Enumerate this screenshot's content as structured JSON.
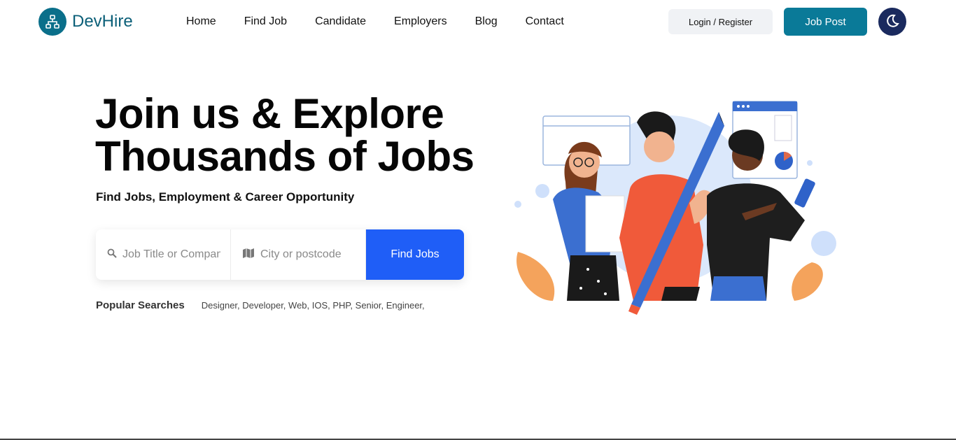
{
  "brand": {
    "name": "DevHire",
    "logo_icon": "sitemap-icon"
  },
  "nav": {
    "items": [
      {
        "label": "Home"
      },
      {
        "label": "Find Job"
      },
      {
        "label": "Candidate"
      },
      {
        "label": "Employers"
      },
      {
        "label": "Blog"
      },
      {
        "label": "Contact"
      }
    ]
  },
  "header_actions": {
    "login_label": "Login / Register",
    "post_label": "Job Post",
    "theme_icon": "moon-icon"
  },
  "hero": {
    "title_line1": "Join us & Explore",
    "title_line2": "Thousands of Jobs",
    "subtitle": "Find Jobs, Employment & Career Opportunity"
  },
  "search": {
    "job_placeholder": "Job Title or Company",
    "location_placeholder": "City or postcode",
    "button_label": "Find Jobs"
  },
  "popular": {
    "label": "Popular Searches",
    "tags": "Designer, Developer, Web, IOS, PHP, Senior, Engineer,"
  },
  "colors": {
    "brand": "#0a6f8a",
    "primary_button": "#0a7a98",
    "find_button": "#1f5ef7",
    "theme_button": "#1a2a5e"
  }
}
